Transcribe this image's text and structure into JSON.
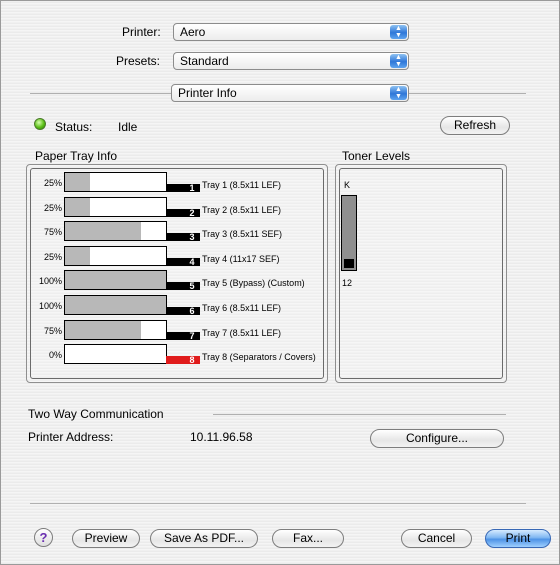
{
  "printer": {
    "label": "Printer:",
    "value": "Aero"
  },
  "presets": {
    "label": "Presets:",
    "value": "Standard"
  },
  "panel": {
    "value": "Printer Info"
  },
  "status": {
    "label": "Status:",
    "value": "Idle",
    "refresh": "Refresh",
    "led_color": "#5bbf16"
  },
  "paper_tray": {
    "title": "Paper Tray Info",
    "trays": [
      {
        "percent": "25%",
        "level": 0.25,
        "number": "1",
        "name": "Tray 1 (8.5x11 LEF)"
      },
      {
        "percent": "25%",
        "level": 0.25,
        "number": "2",
        "name": "Tray 2 (8.5x11 LEF)"
      },
      {
        "percent": "75%",
        "level": 0.75,
        "number": "3",
        "name": "Tray 3 (8.5x11 SEF)"
      },
      {
        "percent": "25%",
        "level": 0.25,
        "number": "4",
        "name": "Tray 4 (11x17 SEF)"
      },
      {
        "percent": "100%",
        "level": 1.0,
        "number": "5",
        "name": "Tray 5 (Bypass) (Custom)"
      },
      {
        "percent": "100%",
        "level": 1.0,
        "number": "6",
        "name": "Tray 6 (8.5x11 LEF)"
      },
      {
        "percent": "75%",
        "level": 0.75,
        "number": "7",
        "name": "Tray 7 (8.5x11 LEF)"
      },
      {
        "percent": "0%",
        "level": 0.0,
        "number": "8",
        "name": "Tray 8 (Separators / Covers)"
      }
    ],
    "empty_color": "#e01b1b"
  },
  "toner": {
    "title": "Toner Levels",
    "color_label": "K",
    "value": "12",
    "level": 0.12
  },
  "two_way": {
    "title": "Two Way Communication",
    "address_label": "Printer Address:",
    "address": "10.11.96.58",
    "configure": "Configure..."
  },
  "footer": {
    "help": "?",
    "preview": "Preview",
    "save_pdf": "Save As PDF...",
    "fax": "Fax...",
    "cancel": "Cancel",
    "print": "Print"
  }
}
